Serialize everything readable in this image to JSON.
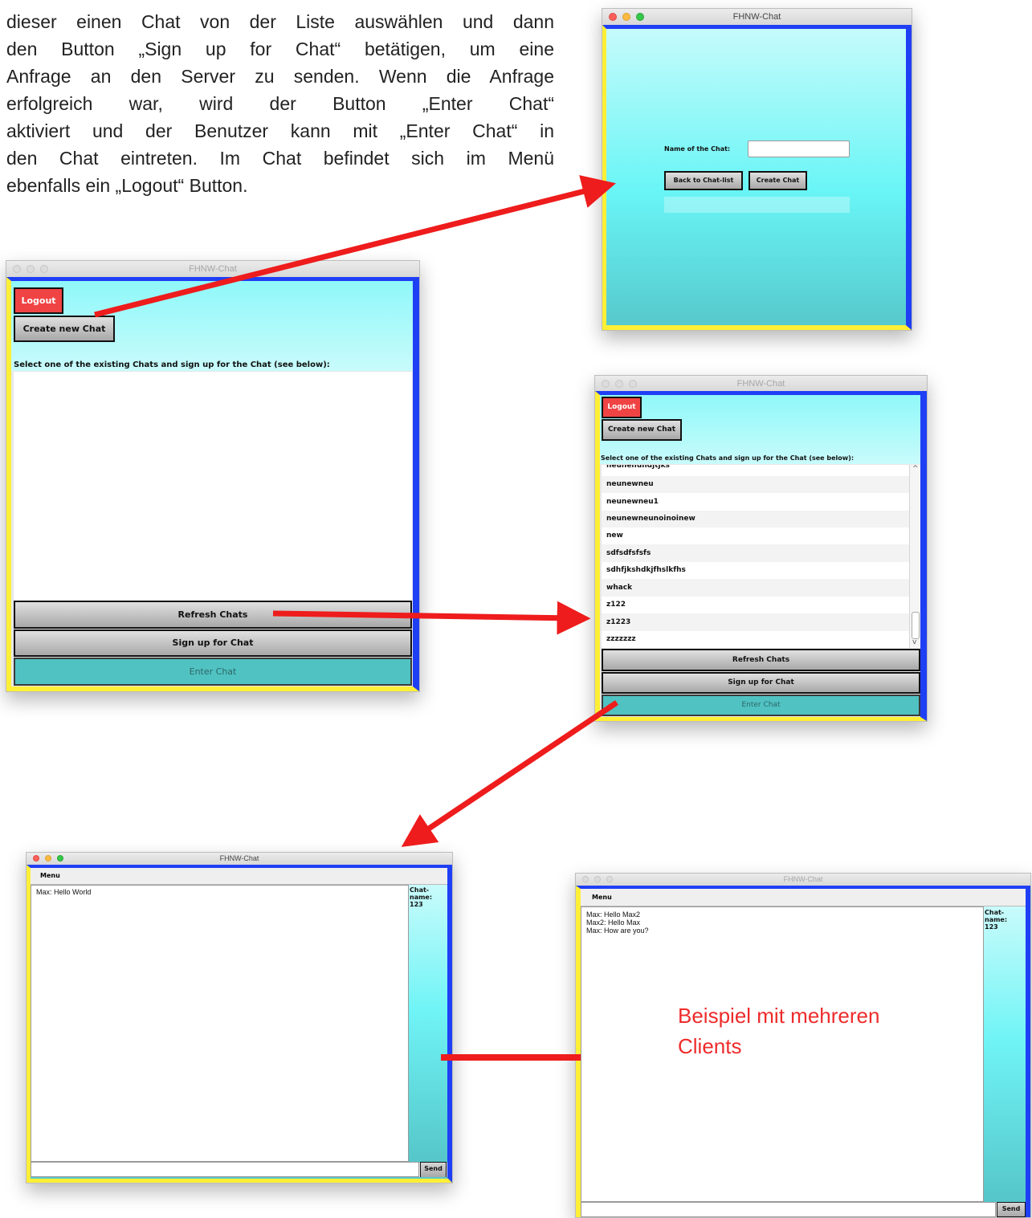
{
  "intro": {
    "lines": [
      "dieser einen Chat von der Liste auswählen und dann",
      "den Button „Sign up for Chat“ betätigen, um eine",
      "Anfrage an den Server zu senden. Wenn die Anfrage",
      "erfolgreich war, wird der Button „Enter Chat“",
      "aktiviert und der Benutzer kann mit „Enter Chat“ in",
      "den Chat eintreten. Im Chat befindet sich im Menü",
      "ebenfalls ein „Logout“ Button."
    ]
  },
  "window_title": "FHNW-Chat",
  "create_window": {
    "name_label": "Name of the Chat:",
    "name_value": "",
    "back_button": "Back to Chat-list",
    "create_button": "Create Chat"
  },
  "chatlist_empty": {
    "logout_button": "Logout",
    "create_new_button": "Create new Chat",
    "instruction": "Select one of the existing Chats and sign up for the Chat (see below):",
    "refresh_button": "Refresh Chats",
    "signup_button": "Sign up for Chat",
    "enter_button": "Enter Chat"
  },
  "chatlist_filled": {
    "logout_button": "Logout",
    "create_new_button": "Create new Chat",
    "instruction": "Select one of the existing Chats and sign up for the Chat (see below):",
    "items": [
      "neunenundjtjks",
      "neunewneu",
      "neunewneu1",
      "neunewneunoinoinew",
      "new",
      "sdfsdfsfsfs",
      "sdhfjkshdkjfhslkfhs",
      "whack",
      "z122",
      "z1223",
      "zzzzzzz"
    ],
    "refresh_button": "Refresh Chats",
    "signup_button": "Sign up for Chat",
    "enter_button": "Enter Chat"
  },
  "chat_single": {
    "menu_label": "Menu",
    "messages": [
      "Max: Hello World"
    ],
    "side_label": "Chat-name:",
    "side_value": "123",
    "send_button": "Send"
  },
  "chat_multi": {
    "menu_label": "Menu",
    "messages": [
      "Max: Hello Max2",
      "Max2: Hello Max",
      "Max: How are you?"
    ],
    "side_label": "Chat-name:",
    "side_value": "123",
    "send_button": "Send"
  },
  "annotation": {
    "text_line1": "Beispiel mit mehreren",
    "text_line2": "Clients"
  },
  "colors": {
    "frame_blue": "#1f3ff5",
    "frame_yellow": "#ffef36",
    "arrow_red": "#ee1c1c",
    "logout_red": "#f04444",
    "teal_disabled": "#50c2c2"
  }
}
